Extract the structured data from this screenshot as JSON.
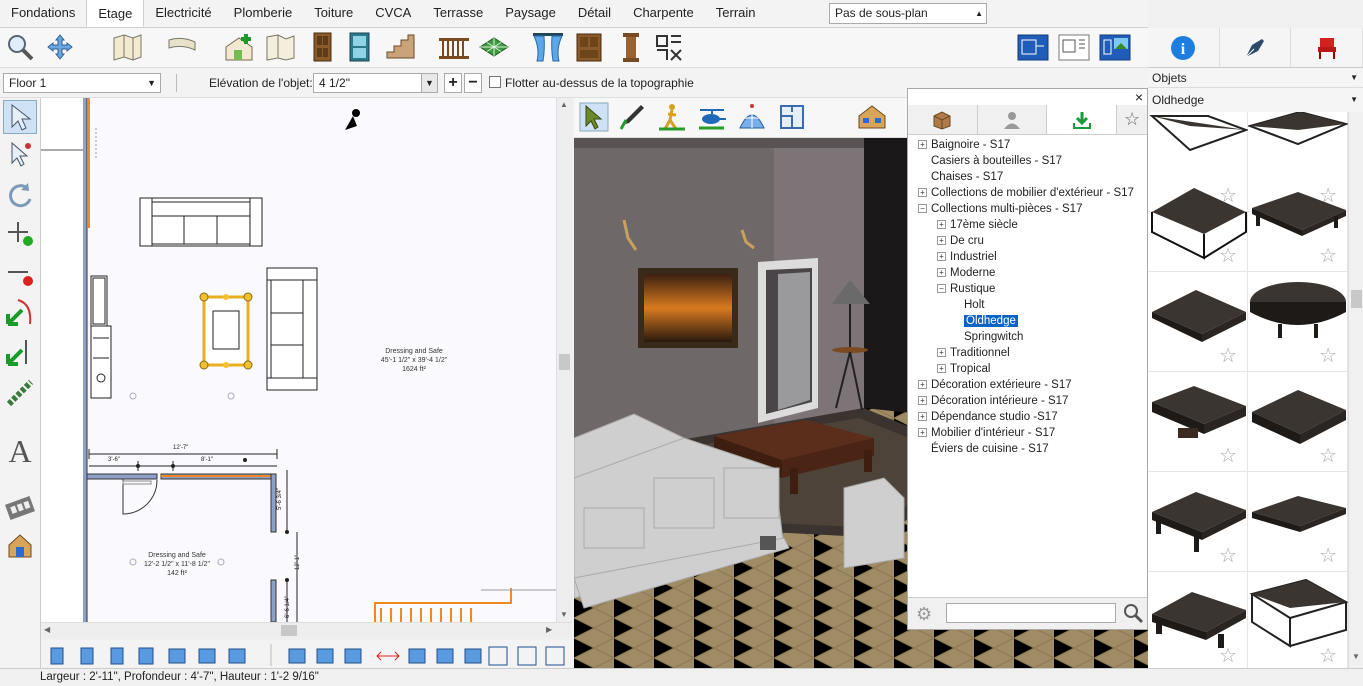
{
  "tabs": [
    "Fondations",
    "Etage",
    "Electricité",
    "Plomberie",
    "Toiture",
    "CVCA",
    "Terrasse",
    "Paysage",
    "Détail",
    "Charpente",
    "Terrain"
  ],
  "active_tab": "Etage",
  "level_select": "Pas de sous-plan",
  "options": {
    "floor": "Floor 1",
    "elevation_label": "Elévation de l'objet:",
    "elevation_value": "4 1/2\"",
    "float_label": "Flotter au-dessus de la topographie"
  },
  "right_panel": {
    "category": "Objets",
    "collection": "Oldhedge"
  },
  "plan": {
    "room1_name": "Dressing and Safe",
    "room1_dims": "45'-1 1/2\" x 39'-4 1/2\"",
    "room1_area": "1624 ft²",
    "room2_name": "Dressing and Safe",
    "room2_dims": "12'-2 1/2\" x 11'-8 1/2\"",
    "room2_area": "142 ft²",
    "dim_total": "12'-7\"",
    "dim_a": "3'-6\"",
    "dim_b": "8'-1\"",
    "dim_c": "5'-6 3/4\"",
    "dim_d": "12'-1\"",
    "dim_e": "6'-6 1/4\""
  },
  "tree": [
    {
      "label": "Baignoire - S17",
      "level": 0,
      "box": "+"
    },
    {
      "label": "Casiers à bouteilles - S17",
      "level": 0,
      "box": ""
    },
    {
      "label": "Chaises - S17",
      "level": 0,
      "box": ""
    },
    {
      "label": "Collections de mobilier d'extérieur - S17",
      "level": 0,
      "box": "+"
    },
    {
      "label": "Collections multi-pièces - S17",
      "level": 0,
      "box": "−"
    },
    {
      "label": "17ème siècle",
      "level": 1,
      "box": "+"
    },
    {
      "label": "De cru",
      "level": 1,
      "box": "+"
    },
    {
      "label": "Industriel",
      "level": 1,
      "box": "+"
    },
    {
      "label": "Moderne",
      "level": 1,
      "box": "+"
    },
    {
      "label": "Rustique",
      "level": 1,
      "box": "−"
    },
    {
      "label": "Holt",
      "level": 2,
      "box": ""
    },
    {
      "label": "Oldhedge",
      "level": 2,
      "box": "",
      "selected": true
    },
    {
      "label": "Springwitch",
      "level": 2,
      "box": ""
    },
    {
      "label": "Traditionnel",
      "level": 1,
      "box": "+"
    },
    {
      "label": "Tropical",
      "level": 1,
      "box": "+"
    },
    {
      "label": "Décoration extérieure - S17",
      "level": 0,
      "box": "+"
    },
    {
      "label": "Décoration intérieure - S17",
      "level": 0,
      "box": "+"
    },
    {
      "label": "Dépendance studio -S17",
      "level": 0,
      "box": "+"
    },
    {
      "label": "Mobilier d'intérieur - S17",
      "level": 0,
      "box": "+"
    },
    {
      "label": "Éviers de cuisine - S17",
      "level": 0,
      "box": ""
    }
  ],
  "search": {
    "value": ""
  },
  "status": "Largeur : 2'-11\", Profondeur : 4'-7\", Hauteur : 1'-2 9/16\""
}
